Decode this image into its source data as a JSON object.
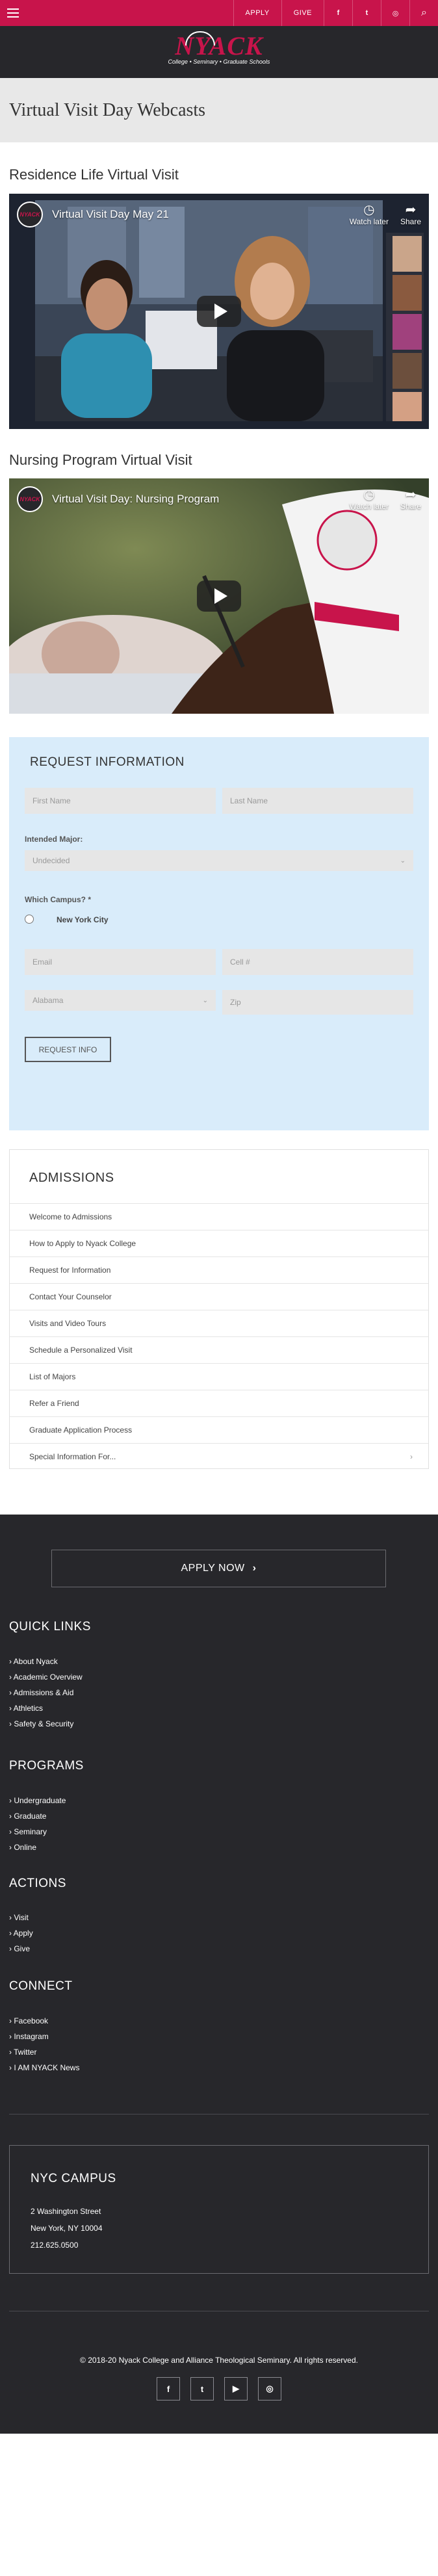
{
  "topbar": {
    "apply": "APPLY",
    "give": "GIVE",
    "facebook_glyph": "f",
    "twitter_glyph": "t",
    "instagram_glyph": "◎",
    "search_glyph": "⌕"
  },
  "logo": {
    "name": "NYACK",
    "tagline": "College • Seminary • Graduate Schools"
  },
  "page_title": "Virtual Visit Day Webcasts",
  "videos": [
    {
      "heading": "Residence Life Virtual Visit",
      "channel_logo": "NYACK",
      "title": "Virtual Visit Day May 21",
      "watch_later": "Watch later",
      "share": "Share"
    },
    {
      "heading": "Nursing Program Virtual Visit",
      "channel_logo": "NYACK",
      "title": "Virtual Visit Day: Nursing Program",
      "watch_later": "Watch later",
      "share": "Share"
    }
  ],
  "form": {
    "title": "REQUEST INFORMATION",
    "first_name": "First Name",
    "last_name": "Last Name",
    "major_label": "Intended Major:",
    "major_value": "Undecided",
    "campus_label": "Which Campus? *",
    "campus_option": "New York City",
    "email": "Email",
    "cell": "Cell #",
    "state_value": "Alabama",
    "zip": "Zip",
    "submit": "REQUEST INFO"
  },
  "admissions": {
    "title": "ADMISSIONS",
    "items": [
      "Welcome to Admissions",
      "How to Apply to Nyack College",
      "Request for Information",
      "Contact Your Counselor",
      "Visits and Video Tours",
      "Schedule a Personalized Visit",
      "List of Majors",
      "Refer a Friend",
      "Graduate Application Process",
      "Special Information For..."
    ]
  },
  "footer": {
    "apply_now": "APPLY NOW",
    "quick_links": {
      "title": "QUICK LINKS",
      "items": [
        "About Nyack",
        "Academic Overview",
        "Admissions & Aid",
        "Athletics",
        "Safety & Security"
      ]
    },
    "programs": {
      "title": "PROGRAMS",
      "items": [
        "Undergraduate",
        "Graduate",
        "Seminary",
        "Online"
      ]
    },
    "actions": {
      "title": "ACTIONS",
      "items": [
        "Visit",
        "Apply",
        "Give"
      ]
    },
    "connect": {
      "title": "CONNECT",
      "items": [
        "Facebook",
        "Instagram",
        "Twitter",
        "I AM NYACK News"
      ]
    },
    "campus": {
      "title": "NYC CAMPUS",
      "street": "2 Washington Street",
      "city": "New York, NY 10004",
      "phone": "212.625.0500"
    },
    "copyright": "© 2018-20 Nyack College and Alliance Theological Seminary. All rights reserved."
  }
}
